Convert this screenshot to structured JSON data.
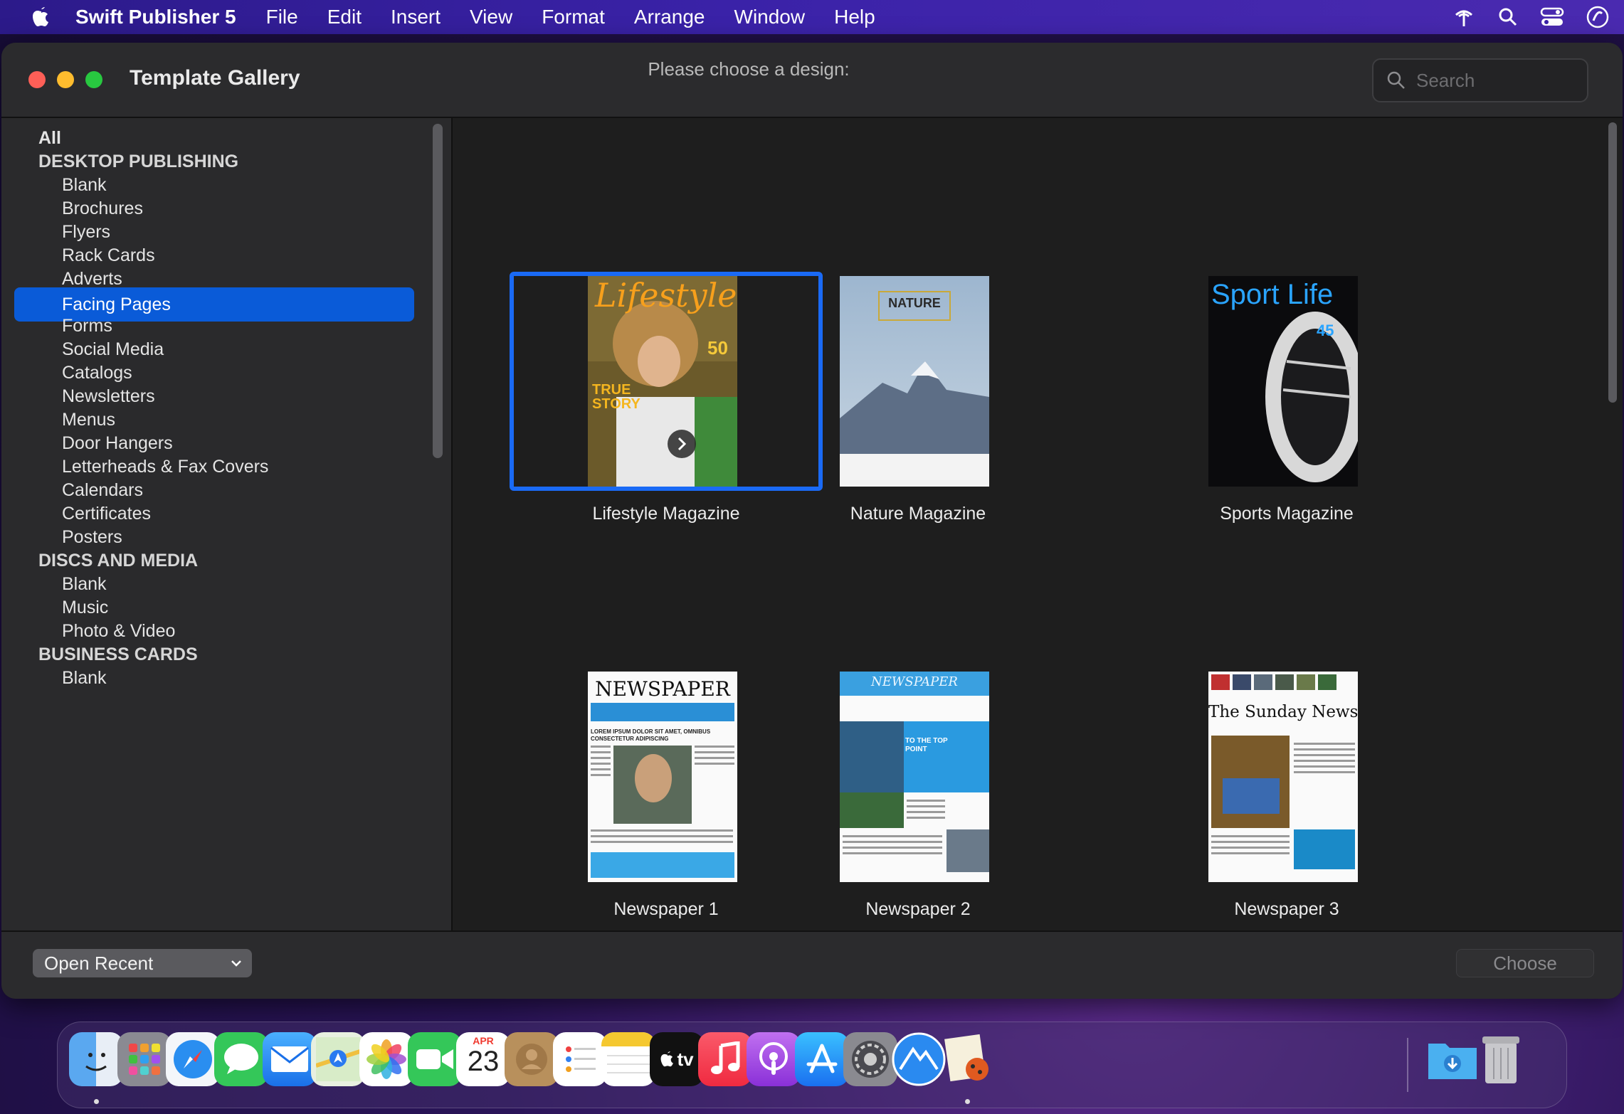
{
  "menubar": {
    "app_name": "Swift Publisher 5",
    "items": [
      "File",
      "Edit",
      "Insert",
      "View",
      "Format",
      "Arrange",
      "Window",
      "Help"
    ]
  },
  "window": {
    "title": "Template Gallery",
    "prompt": "Please choose a design:",
    "search_placeholder": "Search"
  },
  "sidebar": {
    "all_label": "All",
    "sections": [
      {
        "header": "DESKTOP PUBLISHING",
        "items": [
          "Blank",
          "Brochures",
          "Flyers",
          "Rack Cards",
          "Adverts",
          "Facing Pages",
          "Forms",
          "Social Media",
          "Catalogs",
          "Newsletters",
          "Menus",
          "Door Hangers",
          "Letterheads & Fax Covers",
          "Calendars",
          "Certificates",
          "Posters"
        ]
      },
      {
        "header": "DISCS AND MEDIA",
        "items": [
          "Blank",
          "Music",
          "Photo & Video"
        ]
      },
      {
        "header": "BUSINESS CARDS",
        "items": [
          "Blank"
        ]
      }
    ],
    "selected": "Facing Pages"
  },
  "templates": [
    {
      "name": "Lifestyle Magazine",
      "cover_title": "Lifestyle",
      "cover_number": "50",
      "cover_feature": "TRUE STORY",
      "selected": true
    },
    {
      "name": "Nature Magazine",
      "cover_title": "NATURE",
      "selected": false
    },
    {
      "name": "Sports Magazine",
      "cover_title": "Sport Life",
      "cover_number": "45",
      "selected": false
    },
    {
      "name": "Newspaper 1",
      "cover_title": "NEWSPAPER",
      "headline": "LOREM IPSUM DOLOR SIT AMET, OMNIBUS CONSECTETUR ADIPISCING",
      "selected": false
    },
    {
      "name": "Newspaper 2",
      "cover_title": "NEWSPAPER",
      "headline": "TO THE TOP POINT",
      "selected": false
    },
    {
      "name": "Newspaper 3",
      "cover_title": "The Sunday News",
      "selected": false
    }
  ],
  "bottom": {
    "open_recent_label": "Open Recent",
    "choose_label": "Choose"
  },
  "dock": {
    "calendar_month": "APR",
    "calendar_day": "23",
    "tv_label": "tv",
    "apps": [
      "finder",
      "launchpad",
      "safari",
      "messages",
      "mail",
      "maps",
      "photos",
      "facetime",
      "calendar",
      "contacts",
      "reminders",
      "notes",
      "apple-tv",
      "music",
      "podcasts",
      "app-store",
      "system-preferences",
      "swift-publisher-mountain",
      "swift-publisher",
      "downloads-folder",
      "trash"
    ]
  },
  "colors": {
    "selection": "#0a5bd8",
    "tile_selection": "#1a6af5",
    "menubar": "#3a22a8"
  }
}
